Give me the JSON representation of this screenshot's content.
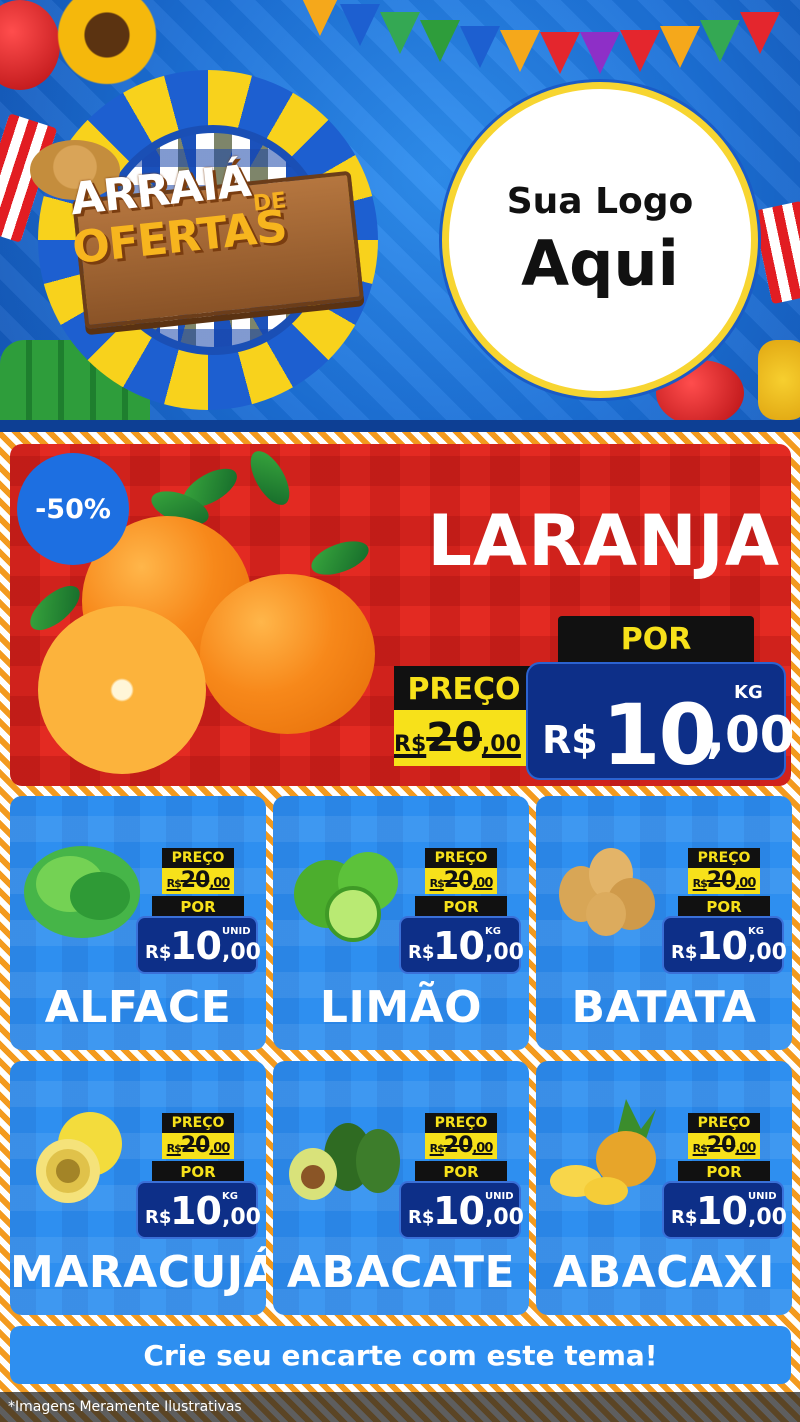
{
  "header": {
    "seal_line1": "ARRAIÁ",
    "seal_line1_suffix": "DE",
    "seal_line2": "OFERTAS",
    "logo_line1": "Sua Logo",
    "logo_line2": "Aqui"
  },
  "hero": {
    "discount": "-50%",
    "title": "LARANJA",
    "old_label": "PREÇO",
    "old_currency": "R$",
    "old_value": "20",
    "old_decimals": ",00",
    "por_label": "POR",
    "new_unit": "KG",
    "new_currency": "R$",
    "new_int": "10",
    "new_dec": ",00"
  },
  "products": [
    {
      "name": "ALFACE",
      "old_label": "PREÇO",
      "old_currency": "R$",
      "old_value": "20",
      "old_dec": ",00",
      "por": "POR",
      "unit": "UNID",
      "cur": "R$",
      "int": "10",
      "dec": ",00"
    },
    {
      "name": "LIMÃO",
      "old_label": "PREÇO",
      "old_currency": "R$",
      "old_value": "20",
      "old_dec": ",00",
      "por": "POR",
      "unit": "KG",
      "cur": "R$",
      "int": "10",
      "dec": ",00"
    },
    {
      "name": "BATATA",
      "old_label": "PREÇO",
      "old_currency": "R$",
      "old_value": "20",
      "old_dec": ",00",
      "por": "POR",
      "unit": "KG",
      "cur": "R$",
      "int": "10",
      "dec": ",00"
    },
    {
      "name": "MARACUJÁ",
      "old_label": "PREÇO",
      "old_currency": "R$",
      "old_value": "20",
      "old_dec": ",00",
      "por": "POR",
      "unit": "KG",
      "cur": "R$",
      "int": "10",
      "dec": ",00"
    },
    {
      "name": "ABACATE",
      "old_label": "PREÇO",
      "old_currency": "R$",
      "old_value": "20",
      "old_dec": ",00",
      "por": "POR",
      "unit": "UNID",
      "cur": "R$",
      "int": "10",
      "dec": ",00"
    },
    {
      "name": "ABACAXI",
      "old_label": "PREÇO",
      "old_currency": "R$",
      "old_value": "20",
      "old_dec": ",00",
      "por": "POR",
      "unit": "UNID",
      "cur": "R$",
      "int": "10",
      "dec": ",00"
    }
  ],
  "cta": "Crie seu encarte com este tema!",
  "footer_note": "*Imagens Meramente Ilustrativas",
  "colors": {
    "header_blue": "#1b6fd6",
    "hero_red": "#e32a22",
    "card_blue": "#2e8ff0",
    "price_navy": "#0d2f88",
    "price_yellow": "#f7e11a",
    "accent_orange": "#f39a1e"
  }
}
